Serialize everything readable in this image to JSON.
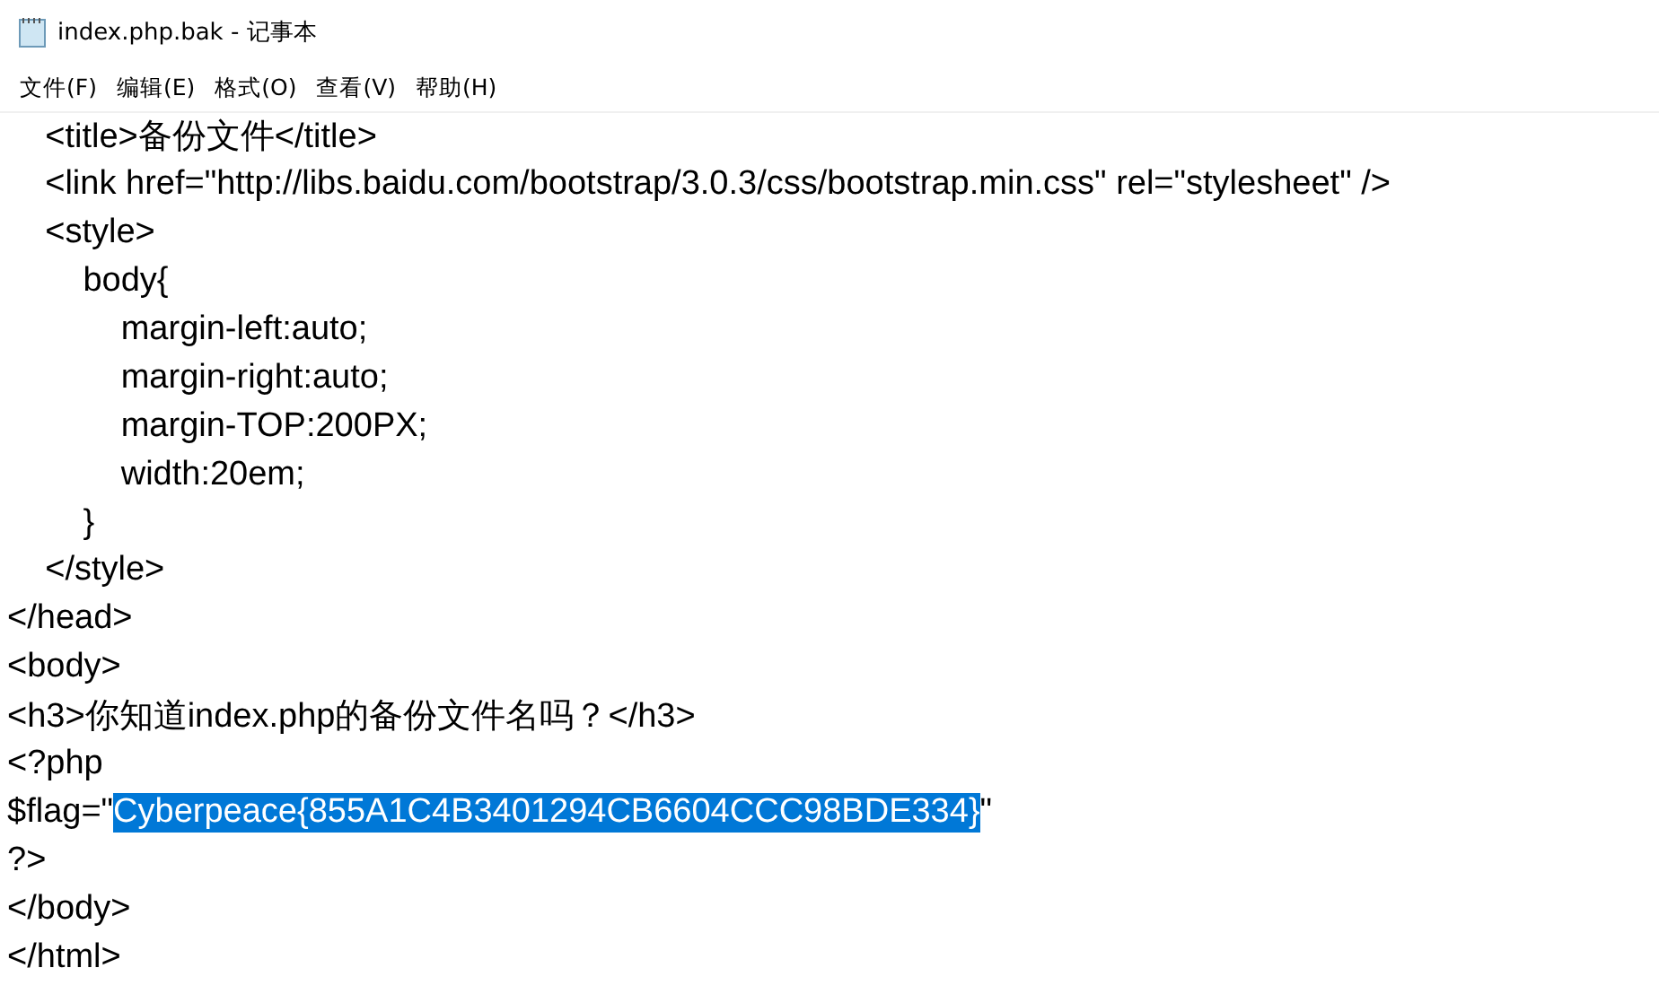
{
  "window": {
    "title": "index.php.bak - 记事本"
  },
  "menu": [
    {
      "label": "文件(F)"
    },
    {
      "label": "编辑(E)"
    },
    {
      "label": "格式(O)"
    },
    {
      "label": "查看(V)"
    },
    {
      "label": "帮助(H)"
    }
  ],
  "lines": [
    {
      "segments": [
        {
          "text": "    <title>备份文件</title>",
          "selected": false
        }
      ]
    },
    {
      "segments": [
        {
          "text": "    <link href=\"http://libs.baidu.com/bootstrap/3.0.3/css/bootstrap.min.css\" rel=\"stylesheet\" />",
          "selected": false
        }
      ]
    },
    {
      "segments": [
        {
          "text": "    <style>",
          "selected": false
        }
      ]
    },
    {
      "segments": [
        {
          "text": "        body{",
          "selected": false
        }
      ]
    },
    {
      "segments": [
        {
          "text": "            margin-left:auto;",
          "selected": false
        }
      ]
    },
    {
      "segments": [
        {
          "text": "            margin-right:auto;",
          "selected": false
        }
      ]
    },
    {
      "segments": [
        {
          "text": "            margin-TOP:200PX;",
          "selected": false
        }
      ]
    },
    {
      "segments": [
        {
          "text": "            width:20em;",
          "selected": false
        }
      ]
    },
    {
      "segments": [
        {
          "text": "        }",
          "selected": false
        }
      ]
    },
    {
      "segments": [
        {
          "text": "    </style>",
          "selected": false
        }
      ]
    },
    {
      "segments": [
        {
          "text": "</head>",
          "selected": false
        }
      ]
    },
    {
      "segments": [
        {
          "text": "<body>",
          "selected": false
        }
      ]
    },
    {
      "segments": [
        {
          "text": "<h3>你知道index.php的备份文件名吗？</h3>",
          "selected": false
        }
      ]
    },
    {
      "segments": [
        {
          "text": "<?php",
          "selected": false
        }
      ]
    },
    {
      "segments": [
        {
          "text": "$flag=\"",
          "selected": false
        },
        {
          "text": "Cyberpeace{855A1C4B3401294CB6604CCC98BDE334}",
          "selected": true
        },
        {
          "text": "\"",
          "selected": false
        }
      ]
    },
    {
      "segments": [
        {
          "text": "?>",
          "selected": false
        }
      ]
    },
    {
      "segments": [
        {
          "text": "</body>",
          "selected": false
        }
      ]
    },
    {
      "segments": [
        {
          "text": "</html>",
          "selected": false
        }
      ]
    }
  ]
}
